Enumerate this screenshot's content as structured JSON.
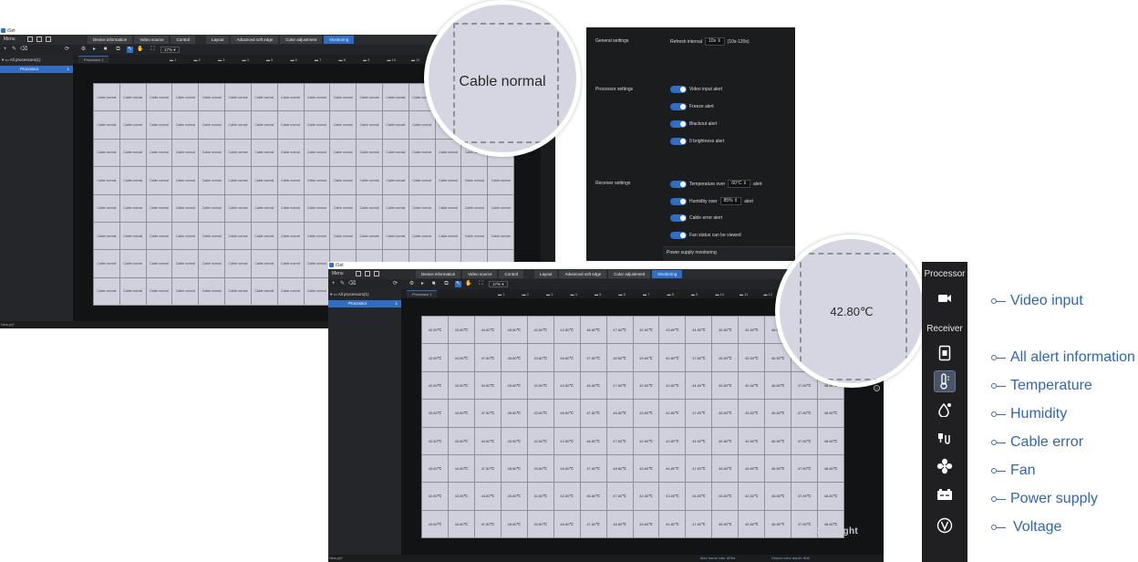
{
  "win1": {
    "title": "iSet",
    "menu_label": "Menu",
    "tabs": [
      "Device information",
      "Video source",
      "Control",
      "Layout",
      "Advanced soft edge",
      "Color adjustment",
      "Monitoring"
    ],
    "zoom": "17%",
    "tree_root": "All processors(1)",
    "tree_item": "Processor",
    "tree_count": "1",
    "ruler_first": "Processor 1",
    "ruler_ports": [
      "1",
      "2",
      "3",
      "4",
      "5",
      "6",
      "7",
      "8",
      "9",
      "10",
      "11",
      "12",
      "13"
    ],
    "cell_text": "Cable normal",
    "status": "New.prj*"
  },
  "magnifier1": {
    "text": "Cable normal"
  },
  "settings": {
    "general_label": "General settings",
    "refresh_label": "Refresh interval",
    "refresh_value": "10s",
    "refresh_range": "(10s-120s)",
    "processor_label": "Processor settings",
    "processor_items": [
      "Video input alert",
      "Freeze alert",
      "Blackout alert",
      "0 brightness alert"
    ],
    "receiver_label": "Receiver settings",
    "temp_label": "Temperature over",
    "temp_value": "60°C",
    "temp_suffix": "alert",
    "humidity_label": "Humidity over",
    "humidity_value": "85%",
    "humidity_suffix": "alert",
    "cable_error": "Cable error alert",
    "fan_status": "Fan status can be viewed",
    "power_supply": "Power supply monitoring"
  },
  "win2": {
    "title": "iSet",
    "menu_label": "Menu",
    "tabs": [
      "Device information",
      "Video source",
      "Control",
      "Layout",
      "Advanced soft edge",
      "Color adjustment",
      "Monitoring"
    ],
    "zoom": "17%",
    "tree_root": "All processors(1)",
    "tree_item": "Processor",
    "tree_count": "1",
    "ruler_first": "Processor 1",
    "ruler_ports": [
      "1",
      "2",
      "3",
      "4",
      "5",
      "6",
      "7",
      "8",
      "9",
      "10",
      "11",
      "12",
      "13"
    ],
    "temps": [
      [
        "42.80℃",
        "43.80℃",
        "44.80℃",
        "45.80℃",
        "42.80℃",
        "42.80℃",
        "46.80℃",
        "47.80℃",
        "42.80℃",
        "43.80℃",
        "44.80℃",
        "45.80℃",
        "42.80℃",
        "46.80℃",
        "47.80℃",
        "48.80℃"
      ],
      [
        "43.80℃",
        "44.80℃",
        "47.80℃",
        "48.80℃",
        "43.80℃",
        "46.80℃",
        "47.80℃",
        "48.80℃",
        "43.80℃",
        "44.80℃",
        "47.80℃",
        "48.80℃",
        "43.80℃",
        "46.80℃",
        "47.80℃",
        "48.80℃"
      ],
      [
        "42.80℃",
        "43.80℃",
        "44.80℃",
        "45.80℃",
        "42.80℃",
        "42.80℃",
        "46.80℃",
        "47.80℃",
        "42.80℃",
        "43.80℃",
        "44.80℃",
        "45.80℃",
        "42.80℃",
        "46.80℃",
        "47.80℃",
        "48.80℃"
      ],
      [
        "43.80℃",
        "44.80℃",
        "47.80℃",
        "48.80℃",
        "43.80℃",
        "46.80℃",
        "47.80℃",
        "48.80℃",
        "43.80℃",
        "44.80℃",
        "47.80℃",
        "48.80℃",
        "43.80℃",
        "46.80℃",
        "47.80℃",
        "48.80℃"
      ],
      [
        "42.80℃",
        "43.80℃",
        "44.80℃",
        "45.80℃",
        "42.80℃",
        "42.80℃",
        "46.80℃",
        "47.80℃",
        "42.80℃",
        "43.80℃",
        "44.80℃",
        "45.80℃",
        "42.80℃",
        "46.80℃",
        "47.80℃",
        "48.80℃"
      ],
      [
        "43.80℃",
        "44.80℃",
        "47.80℃",
        "48.80℃",
        "43.80℃",
        "46.80℃",
        "47.80℃",
        "48.80℃",
        "43.80℃",
        "44.80℃",
        "47.80℃",
        "48.80℃",
        "43.80℃",
        "46.80℃",
        "47.80℃",
        "48.80℃"
      ],
      [
        "42.80℃",
        "43.80℃",
        "44.80℃",
        "45.80℃",
        "42.80℃",
        "42.80℃",
        "46.80℃",
        "47.80℃",
        "42.80℃",
        "43.80℃",
        "44.80℃",
        "45.80℃",
        "42.80℃",
        "46.80℃",
        "47.80℃",
        "48.80℃"
      ],
      [
        "43.80℃",
        "44.80℃",
        "47.80℃",
        "48.80℃",
        "43.80℃",
        "46.80℃",
        "47.80℃",
        "48.80℃",
        "43.80℃",
        "44.80℃",
        "47.80℃",
        "48.80℃",
        "43.80℃",
        "46.80℃",
        "47.80℃",
        "48.80℃"
      ]
    ],
    "watermark": "Colorlight",
    "status": "New.prj*",
    "status_frame": "Max frame rate: 60Hz",
    "status_depth": "Output color depth: 8bit"
  },
  "magnifier2": {
    "text": "42.80℃"
  },
  "legend": {
    "processor_heading": "Processor",
    "receiver_heading": "Receiver",
    "items": [
      {
        "label": "Video input",
        "icon": "video-camera-icon"
      },
      {
        "label": "All alert information",
        "icon": "receiver-card-icon"
      },
      {
        "label": "Temperature",
        "icon": "thermometer-icon"
      },
      {
        "label": "Humidity",
        "icon": "humidity-drop-icon"
      },
      {
        "label": "Cable error",
        "icon": "cable-icon"
      },
      {
        "label": "Fan",
        "icon": "fan-icon"
      },
      {
        "label": "Power supply",
        "icon": "power-supply-icon"
      },
      {
        "label": "Voltage",
        "icon": "voltage-icon"
      }
    ],
    "line_color": "#3b6cb3",
    "text_color": "#2f66b3"
  }
}
